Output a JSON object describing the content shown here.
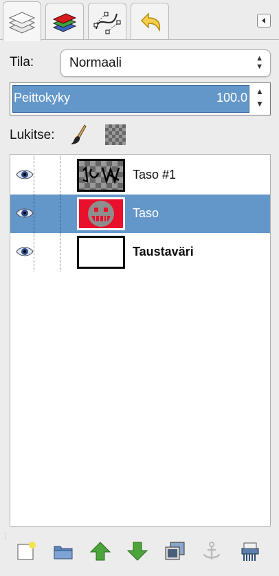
{
  "tabs": [
    {
      "name": "layers-icon",
      "active": true
    },
    {
      "name": "channels-icon",
      "active": false
    },
    {
      "name": "paths-icon",
      "active": false
    },
    {
      "name": "undo-history-icon",
      "active": false
    }
  ],
  "panel_menu_icon": "triangle-left-icon",
  "mode": {
    "label": "Tila:",
    "value": "Normaali"
  },
  "opacity": {
    "label": "Peittokyky",
    "value": "100.0",
    "fraction": 1.0
  },
  "lock": {
    "label": "Lukitse:",
    "icons": [
      "brush-lock-icon",
      "alpha-lock-icon"
    ]
  },
  "layers": [
    {
      "name": "Taso #1",
      "visible": true,
      "selected": false,
      "bold": false
    },
    {
      "name": "Taso",
      "visible": true,
      "selected": true,
      "bold": false
    },
    {
      "name": "Taustaväri",
      "visible": true,
      "selected": false,
      "bold": true
    }
  ],
  "bottom_buttons": [
    "new-layer-icon",
    "layer-group-icon",
    "raise-layer-icon",
    "lower-layer-icon",
    "duplicate-layer-icon",
    "anchor-icon",
    "delete-layer-icon"
  ],
  "colors": {
    "selection": "#6497c9",
    "accent_red": "#e8102a",
    "arrow_green": "#4ca43a"
  }
}
